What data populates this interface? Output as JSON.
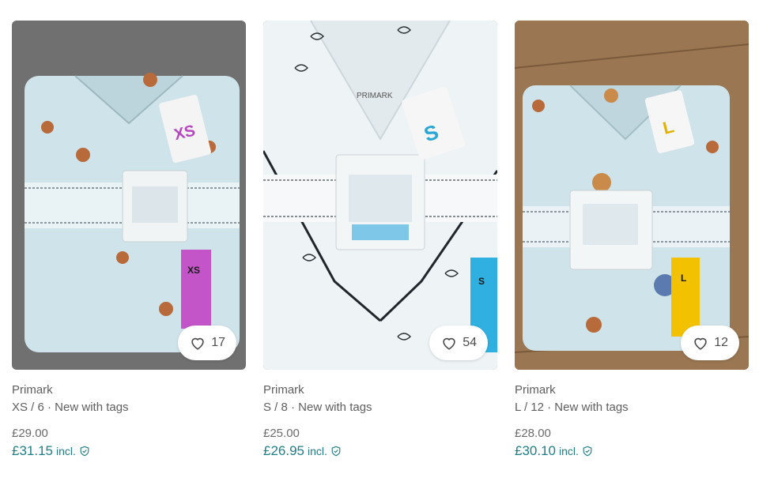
{
  "items": [
    {
      "brand": "Primark",
      "size": "XS / 6 · New with tags",
      "price": "£29.00",
      "price_incl": "£31.15",
      "incl_label": "incl.",
      "favorites": "17",
      "size_tag": "XS",
      "tag_color": "#b845c2",
      "photo_bg": "#6e6e6e"
    },
    {
      "brand": "Primark",
      "size": "S / 8 · New with tags",
      "price": "£25.00",
      "price_incl": "£26.95",
      "incl_label": "incl.",
      "favorites": "54",
      "size_tag": "S",
      "tag_color": "#29a8d8",
      "photo_bg": "#e9eff3"
    },
    {
      "brand": "Primark",
      "size": "L / 12 · New with tags",
      "price": "£28.00",
      "price_incl": "£30.10",
      "incl_label": "incl.",
      "favorites": "12",
      "size_tag": "L",
      "tag_color": "#f2c200",
      "photo_bg": "#8a6a48"
    }
  ],
  "colors": {
    "accent": "#1f7f86",
    "pajama_blue": "#cfe3ea"
  },
  "icons": {
    "favorite": "heart-icon",
    "buyer_protection": "shield-check-icon"
  }
}
